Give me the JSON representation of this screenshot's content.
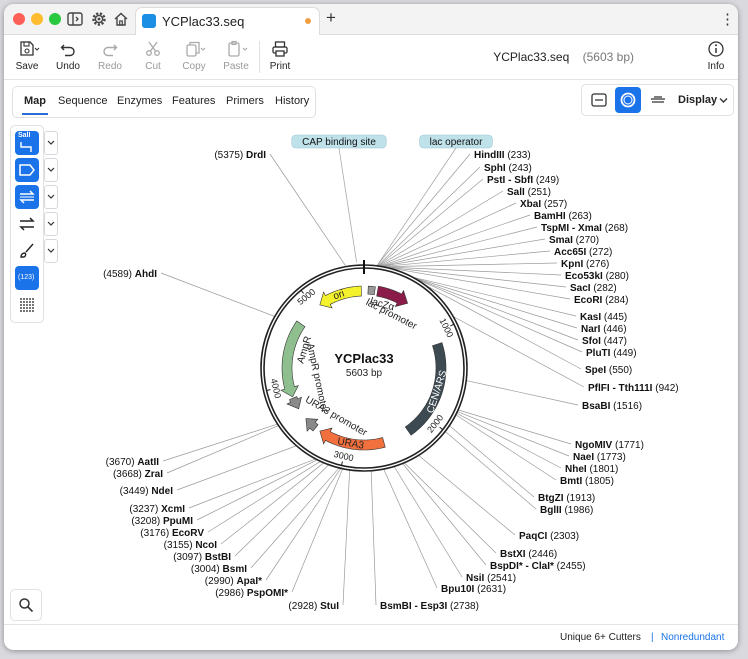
{
  "window": {
    "tab_title": "YCPlac33.seq",
    "new_tab_label": "+",
    "more_label": "⋮"
  },
  "toolbar": {
    "save_label": "Save",
    "undo_label": "Undo",
    "redo_label": "Redo",
    "cut_label": "Cut",
    "copy_label": "Copy",
    "paste_label": "Paste",
    "print_label": "Print",
    "info_label": "Info",
    "file_name": "YCPlac33.seq",
    "file_size": "(5603 bp)"
  },
  "view_tabs": [
    {
      "label": "Map",
      "active": true
    },
    {
      "label": "Sequence",
      "active": false
    },
    {
      "label": "Enzymes",
      "active": false
    },
    {
      "label": "Features",
      "active": false
    },
    {
      "label": "Primers",
      "active": false
    },
    {
      "label": "History",
      "active": false
    }
  ],
  "display_control": {
    "label": "Display",
    "active_view": "circular"
  },
  "left_panel": {
    "enzyme_button_text": "SalI",
    "numbers_button_text": "(123)"
  },
  "map": {
    "name": "YCPlac33",
    "length": "5603 bp",
    "ticks": [
      "1000",
      "2000",
      "3000",
      "4000",
      "5000"
    ],
    "features": [
      {
        "name": "ori",
        "color": "#f4f22c",
        "direction": "ccw"
      },
      {
        "name": "lacZα",
        "color": "#8b1c4a",
        "direction": "cw"
      },
      {
        "name": "lac promoter",
        "color": "#7a7a7a",
        "direction": "cw"
      },
      {
        "name": "CEN/ARS",
        "color": "#3e4a52",
        "direction": "none"
      },
      {
        "name": "URA3",
        "color": "#f2703d",
        "direction": "cw"
      },
      {
        "name": "URA3 promoter",
        "color": "#8a8a8a",
        "direction": "cw"
      },
      {
        "name": "AmpR",
        "color": "#8fbf8f",
        "direction": "ccw"
      },
      {
        "name": "AmpR promoter",
        "color": "#8a8a8a",
        "direction": "ccw"
      }
    ],
    "site_labels": [
      "CAP binding site",
      "lac operator"
    ],
    "enzymes": [
      {
        "name": "DrdI",
        "pos": "(5375)"
      },
      {
        "name": "AhdI",
        "pos": "(4589)"
      },
      {
        "name": "HindIII",
        "pos": "(233)"
      },
      {
        "name": "SphI",
        "pos": "(243)"
      },
      {
        "name": "PstI - SbfI",
        "pos": "(249)"
      },
      {
        "name": "SalI",
        "pos": "(251)"
      },
      {
        "name": "XbaI",
        "pos": "(257)"
      },
      {
        "name": "BamHI",
        "pos": "(263)"
      },
      {
        "name": "TspMI - XmaI",
        "pos": "(268)"
      },
      {
        "name": "SmaI",
        "pos": "(270)"
      },
      {
        "name": "Acc65I",
        "pos": "(272)"
      },
      {
        "name": "KpnI",
        "pos": "(276)"
      },
      {
        "name": "Eco53kI",
        "pos": "(280)"
      },
      {
        "name": "SacI",
        "pos": "(282)"
      },
      {
        "name": "EcoRI",
        "pos": "(284)"
      },
      {
        "name": "KasI",
        "pos": "(445)"
      },
      {
        "name": "NarI",
        "pos": "(446)"
      },
      {
        "name": "SfoI",
        "pos": "(447)"
      },
      {
        "name": "PluTI",
        "pos": "(449)"
      },
      {
        "name": "SpeI",
        "pos": "(550)"
      },
      {
        "name": "PflFI - Tth111I",
        "pos": "(942)"
      },
      {
        "name": "BsaBI",
        "pos": "(1516)"
      },
      {
        "name": "NgoMIV",
        "pos": "(1771)"
      },
      {
        "name": "NaeI",
        "pos": "(1773)"
      },
      {
        "name": "NheI",
        "pos": "(1801)"
      },
      {
        "name": "BmtI",
        "pos": "(1805)"
      },
      {
        "name": "BtgZI",
        "pos": "(1913)"
      },
      {
        "name": "BglII",
        "pos": "(1986)"
      },
      {
        "name": "PaqCI",
        "pos": "(2303)"
      },
      {
        "name": "BstXI",
        "pos": "(2446)"
      },
      {
        "name": "BspDI* - ClaI*",
        "pos": "(2455)"
      },
      {
        "name": "NsiI",
        "pos": "(2541)"
      },
      {
        "name": "Bpu10I",
        "pos": "(2631)"
      },
      {
        "name": "BsmBI - Esp3I",
        "pos": "(2738)"
      },
      {
        "name": "StuI",
        "pos": "(2928)"
      },
      {
        "name": "PspOMI*",
        "pos": "(2986)"
      },
      {
        "name": "ApaI*",
        "pos": "(2990)"
      },
      {
        "name": "BsmI",
        "pos": "(3004)"
      },
      {
        "name": "BstBI",
        "pos": "(3097)"
      },
      {
        "name": "NcoI",
        "pos": "(3155)"
      },
      {
        "name": "EcoRV",
        "pos": "(3176)"
      },
      {
        "name": "PpuMI",
        "pos": "(3208)"
      },
      {
        "name": "XcmI",
        "pos": "(3237)"
      },
      {
        "name": "NdeI",
        "pos": "(3449)"
      },
      {
        "name": "ZraI",
        "pos": "(3668)"
      },
      {
        "name": "AatII",
        "pos": "(3670)"
      }
    ]
  },
  "status_bar": {
    "cutters_label": "Unique 6+ Cutters",
    "separator": "|",
    "mode_label": "Nonredundant"
  }
}
